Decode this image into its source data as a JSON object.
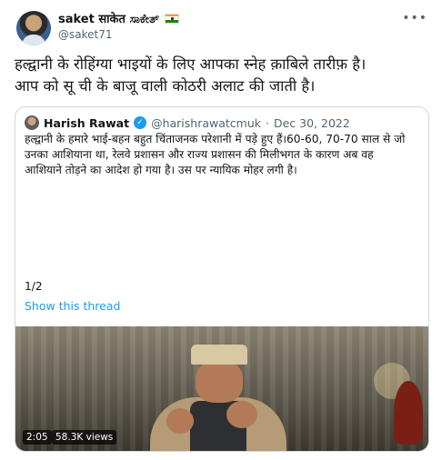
{
  "tweet": {
    "display_name": "saket साकेत ಸಾಕೇತ್",
    "handle": "@saket71",
    "more_icon": "more-dots-icon",
    "flag_icon": "india-flag-icon",
    "text_line1": "हल्द्वानी के रोहिंग्या भाइयों के लिए आपका स्नेह क़ाबिले तारीफ़ है।",
    "text_line2": "आप को सू ची के बाजू वाली कोठरी अलाट की जाती है।"
  },
  "quote": {
    "name": "Harish Rawat",
    "verified_icon": "verified-badge-icon",
    "handle": "@harishrawatcmuk",
    "separator": "·",
    "date": "Dec 30, 2022",
    "body_line1": "हल्द्वानी के हमारे भाई-बहन बहुत चिंताजनक परेशानी में पड़े हुए हैं।60-60,  70-70 साल से जो",
    "body_line2": "उनका आशियाना था, रेलवे प्रशासन और राज्य प्रशासन की मिलीभगत के कारण अब वह",
    "body_line3": "आशियाने तोड़ने का आदेश हो गया है। उस पर न्यायिक मोहर लगी है।",
    "count": "1/2",
    "show_thread": "Show this thread",
    "video": {
      "duration": "2:05",
      "views": "58.3K views"
    }
  },
  "colors": {
    "accent": "#1d9bf0",
    "secondary_text": "#536471",
    "border": "#cfd9de"
  }
}
